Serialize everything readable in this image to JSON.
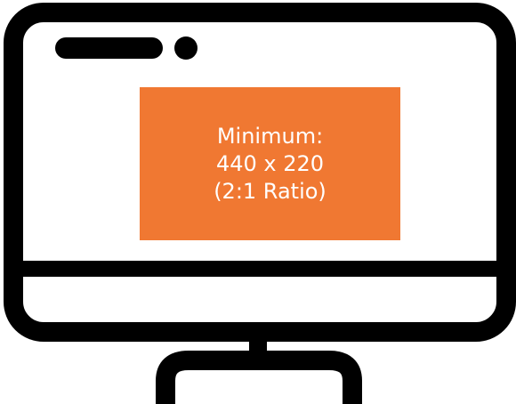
{
  "banner": {
    "line1": "Minimum:",
    "line2": "440 x 220",
    "line3": "(2:1 Ratio)",
    "color": "#f07832"
  },
  "monitor": {
    "icon": "desktop-monitor-icon",
    "outline_color": "#000000",
    "screen_color": "#ffffff"
  }
}
